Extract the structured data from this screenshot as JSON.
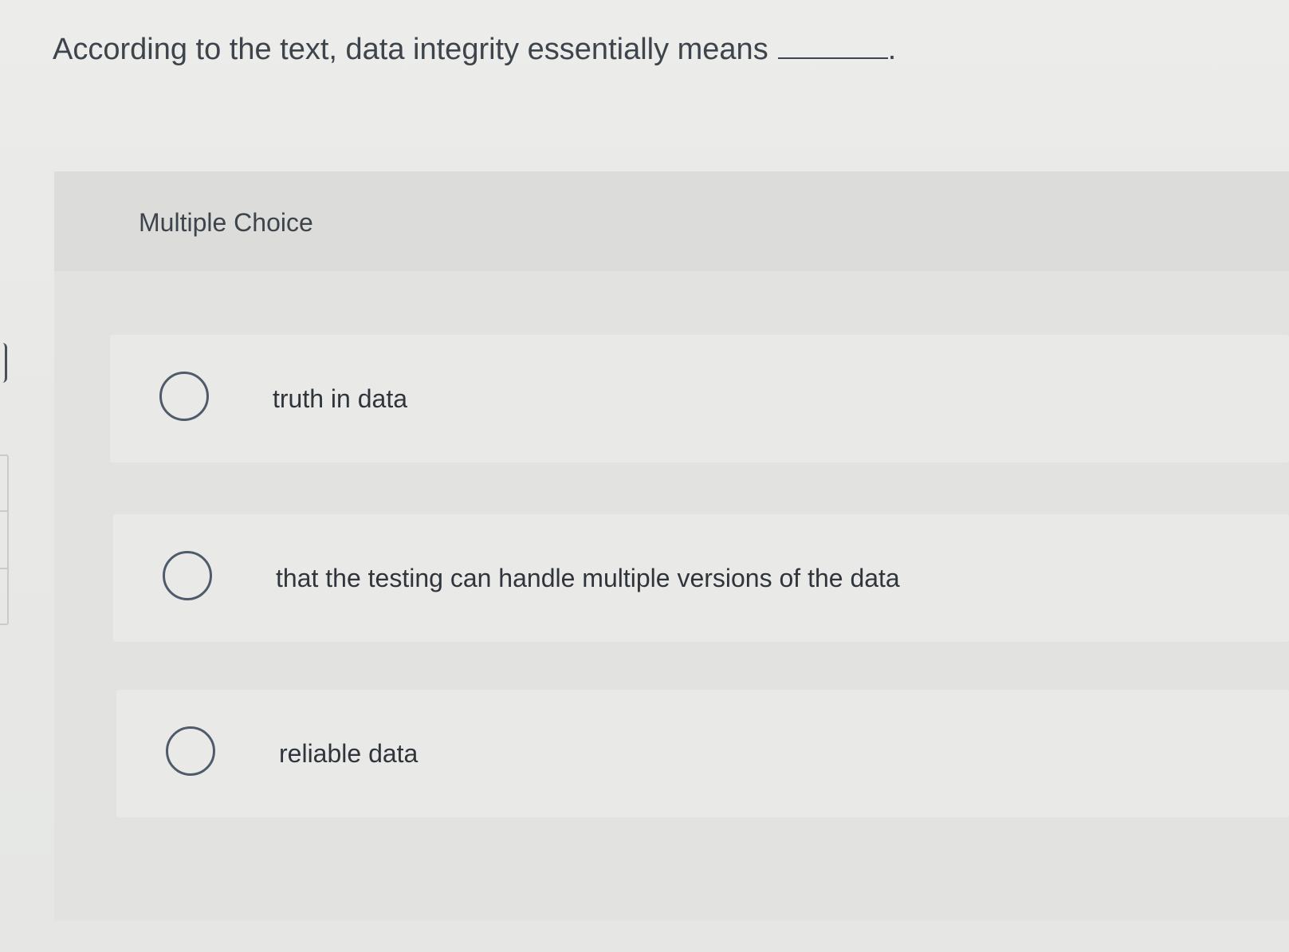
{
  "question": {
    "text": "According to the text, data integrity essentially means",
    "terminator": "."
  },
  "multiple_choice": {
    "title": "Multiple Choice",
    "options": [
      {
        "label": "truth in data",
        "selected": false
      },
      {
        "label": "that the testing can handle multiple versions of the data",
        "selected": false
      },
      {
        "label": "reliable data",
        "selected": false
      }
    ]
  },
  "colors": {
    "page_background": "#ececea",
    "panel_background": "#e2e3e1",
    "option_background": "#e9eae8",
    "radio_border": "#4f5b6b",
    "text": "#3d444b"
  }
}
